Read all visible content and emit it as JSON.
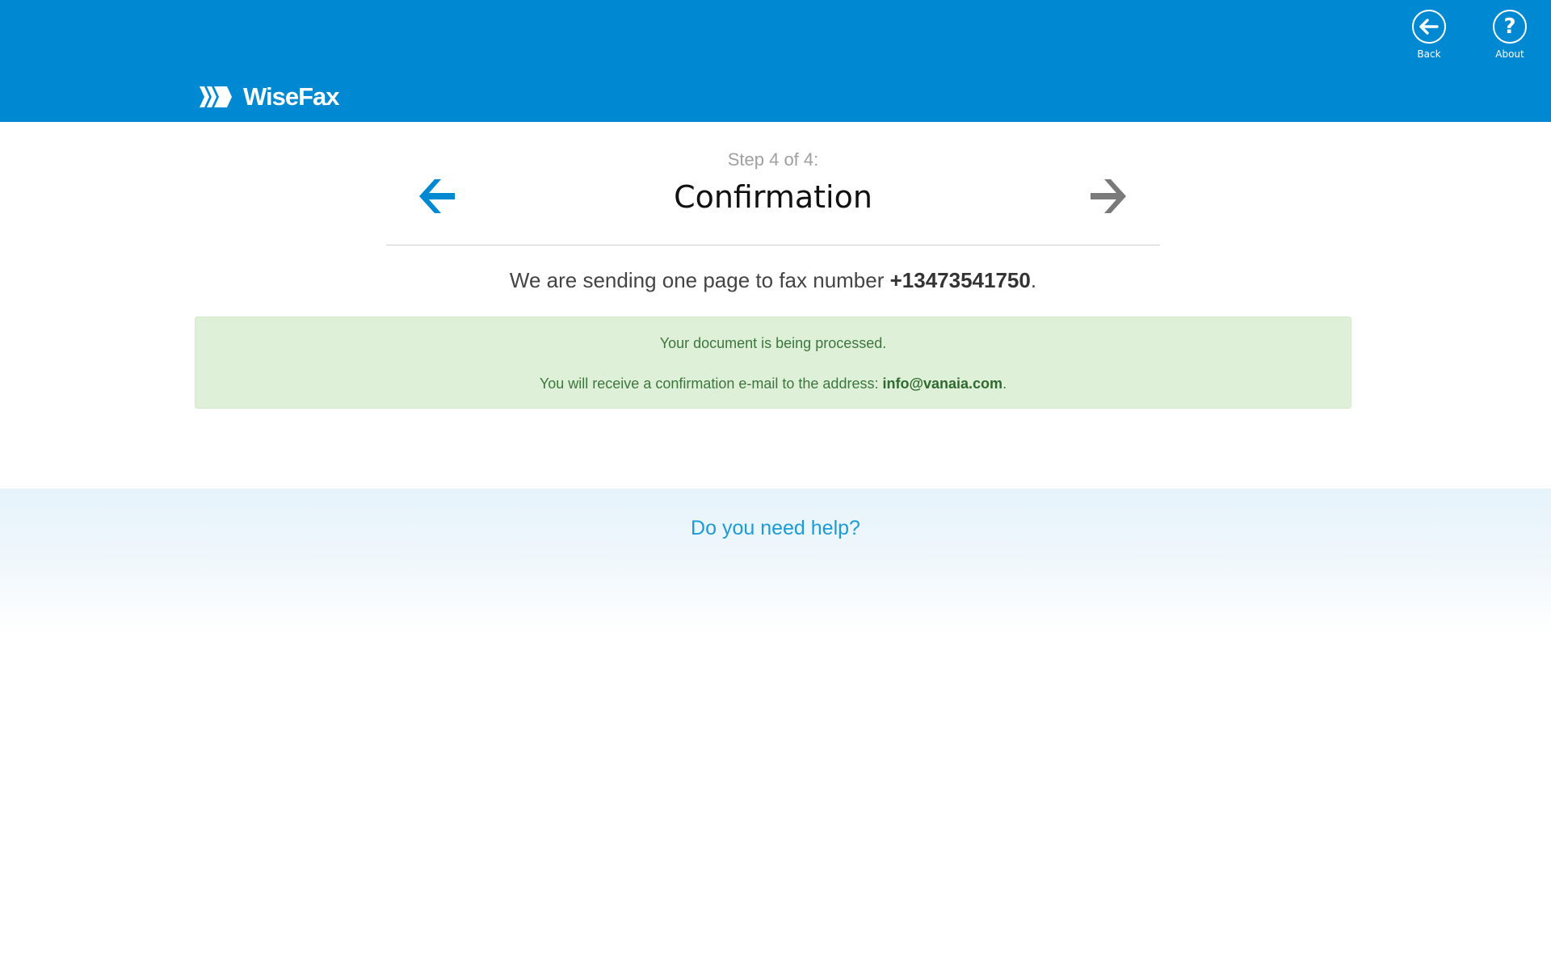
{
  "header": {
    "logo_text": "WiseFax",
    "app_bar": {
      "back_label": "Back",
      "about_label": "About"
    }
  },
  "wizard": {
    "step_label": "Step 4 of 4:",
    "title": "Confirmation"
  },
  "summary": {
    "prefix": "We are sending one page to fax number ",
    "fax_number": "+13473541750",
    "suffix": "."
  },
  "alert": {
    "line1": "Your document is being processed.",
    "line2_prefix": "You will receive a confirmation e-mail to the address: ",
    "email": "info@vanaia.com",
    "line2_suffix": "."
  },
  "help": {
    "link_text": "Do you need help?"
  },
  "colors": {
    "header_bg": "#0089d3",
    "prev_arrow": "#0089d3",
    "next_arrow": "#7a7a7a",
    "alert_bg": "#dff0d8",
    "alert_text": "#3c763d",
    "help_link": "#1a9cd8"
  }
}
